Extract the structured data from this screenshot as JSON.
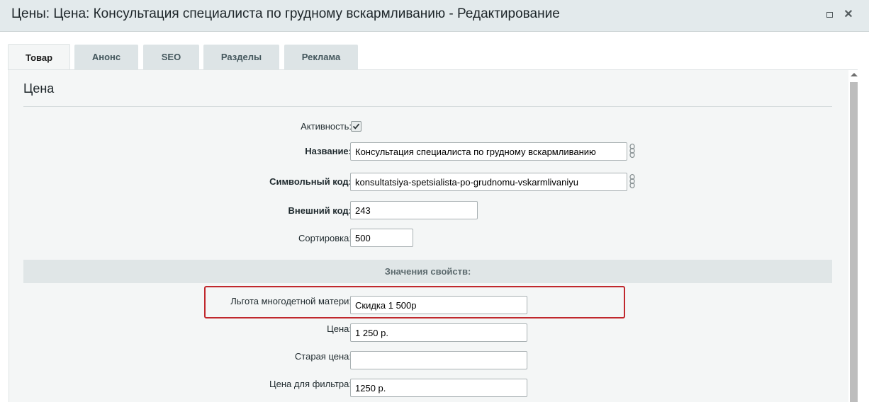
{
  "window": {
    "title": "Цены: Цена: Консультация специалиста по грудному вскармливанию - Редактирование",
    "maximize_icon": "maximize-icon",
    "close_icon": "✕"
  },
  "tabs": [
    {
      "label": "Товар",
      "active": true
    },
    {
      "label": "Анонс",
      "active": false
    },
    {
      "label": "SEO",
      "active": false
    },
    {
      "label": "Разделы",
      "active": false
    },
    {
      "label": "Реклама",
      "active": false
    }
  ],
  "section": {
    "title": "Цена"
  },
  "fields": {
    "active": {
      "label": "Активность:",
      "checked": true
    },
    "name": {
      "label": "Название:",
      "value": "Консультация специалиста по грудному вскармливанию"
    },
    "code": {
      "label": "Символьный код:",
      "value": "konsultatsiya-spetsialista-po-grudnomu-vskarmlivaniyu"
    },
    "external_code": {
      "label": "Внешний код:",
      "value": "243"
    },
    "sort": {
      "label": "Сортировка:",
      "value": "500"
    }
  },
  "properties": {
    "header": "Значения свойств:",
    "benefit": {
      "label": "Льгота многодетной матери:",
      "value": "Скидка 1 500р"
    },
    "price": {
      "label": "Цена:",
      "value": "1 250 р."
    },
    "old_price": {
      "label": "Старая цена:",
      "value": ""
    },
    "filter_price": {
      "label": "Цена для фильтра:",
      "value": "1250 р."
    }
  },
  "colors": {
    "highlight": "#c0282d",
    "title_bar": "#e3eaec",
    "panel": "#f4f6f6"
  }
}
